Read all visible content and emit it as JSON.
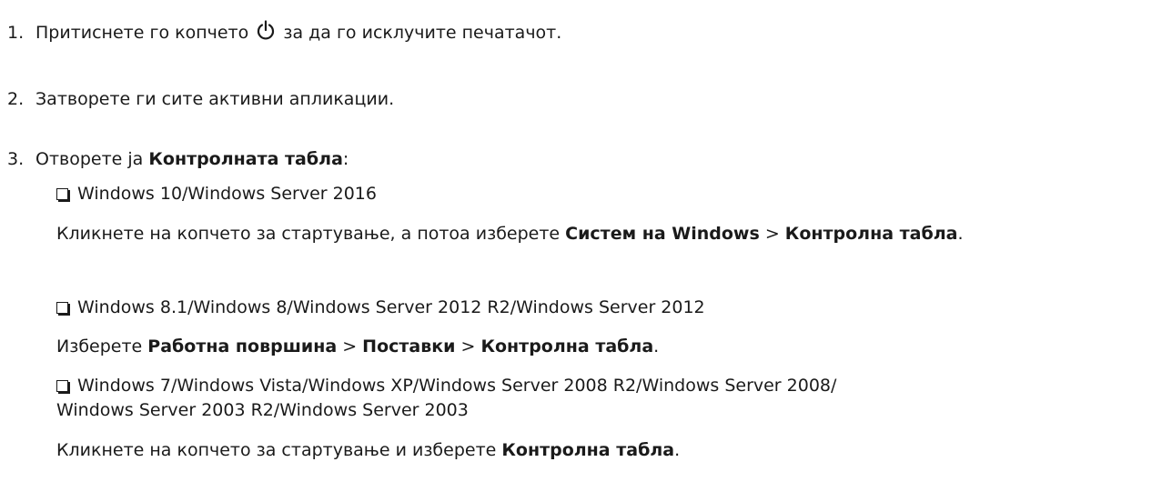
{
  "steps": [
    {
      "num": "1.",
      "before_icon": "Притиснете го копчето",
      "icon": "power-icon",
      "after_icon": "за да го исклучите печатачот."
    },
    {
      "num": "2.",
      "text": "Затворете ги сите активни апликации."
    },
    {
      "num": "3.",
      "before": "Отворете ја ",
      "bold": "Контролната табла",
      "after": ":"
    }
  ],
  "options": [
    {
      "title": "Windows 10/Windows Server 2016",
      "desc_pre": "Кликнете на копчето за стартување, а потоа изберете ",
      "desc_b1": "Систем на Windows",
      "desc_sep": " > ",
      "desc_b2": "Контролна табла",
      "desc_end": "."
    },
    {
      "title": "Windows 8.1/Windows 8/Windows Server 2012 R2/Windows Server 2012",
      "desc_pre": "Изберете ",
      "desc_b1": "Работна површина",
      "desc_sep1": " > ",
      "desc_b2": "Поставки",
      "desc_sep2": " > ",
      "desc_b3": "Контролна табла",
      "desc_end": "."
    },
    {
      "title_line1": "Windows 7/Windows Vista/Windows XP/Windows Server 2008 R2/Windows Server 2008/",
      "title_line2": "Windows Server 2003 R2/Windows Server 2003",
      "desc_pre": "Кликнете на копчето за стартување и изберете ",
      "desc_b1": "Контролна табла",
      "desc_end": "."
    }
  ]
}
